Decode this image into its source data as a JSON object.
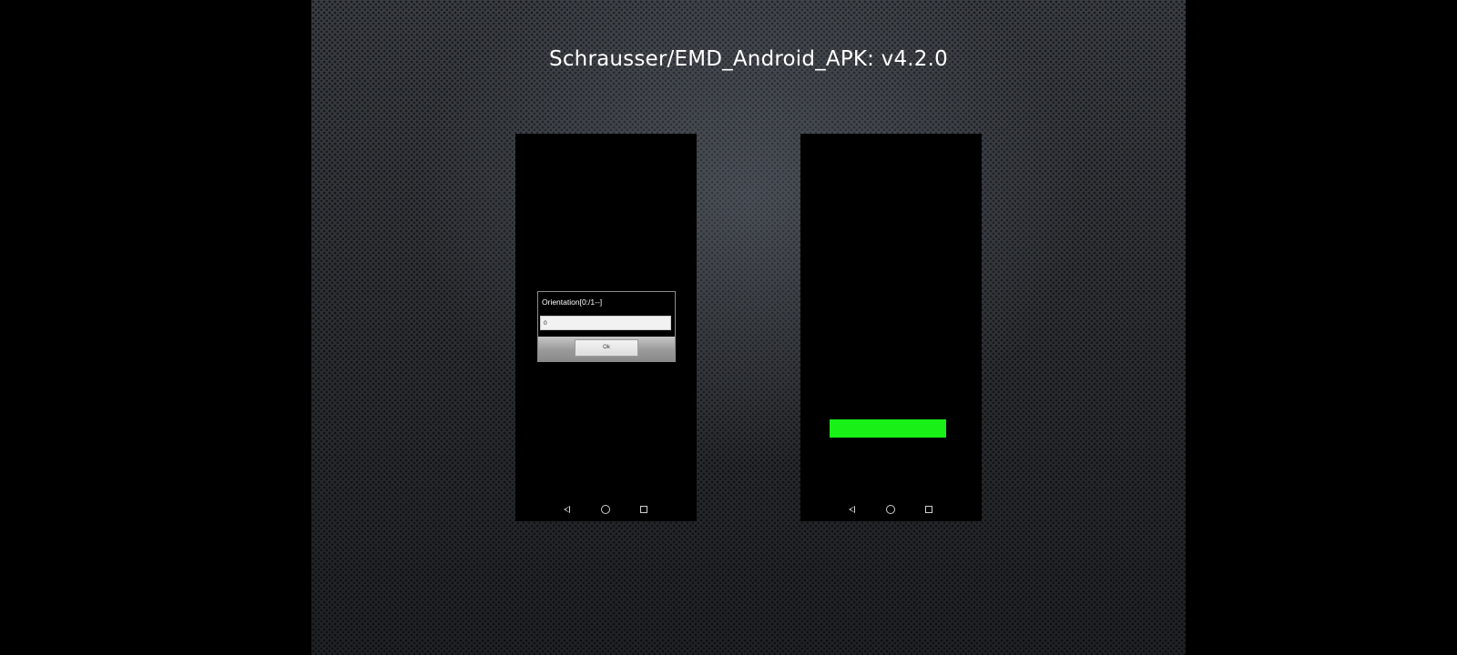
{
  "title": "Schrausser/EMD_Android_APK: v4.2.0",
  "colors": {
    "background": "#000000",
    "panel": "#2c2f33",
    "green_bar": "#18f018"
  },
  "left_phone": {
    "dialog": {
      "title": "Orientation[0:/1--]",
      "input_value": "0",
      "ok_label": "Ok"
    },
    "nav": {
      "back_icon": "back-triangle-icon",
      "home_icon": "home-circle-icon",
      "recent_icon": "recent-square-icon"
    }
  },
  "right_phone": {
    "bar_color": "#18f018",
    "nav": {
      "back_icon": "back-triangle-icon",
      "home_icon": "home-circle-icon",
      "recent_icon": "recent-square-icon"
    }
  }
}
